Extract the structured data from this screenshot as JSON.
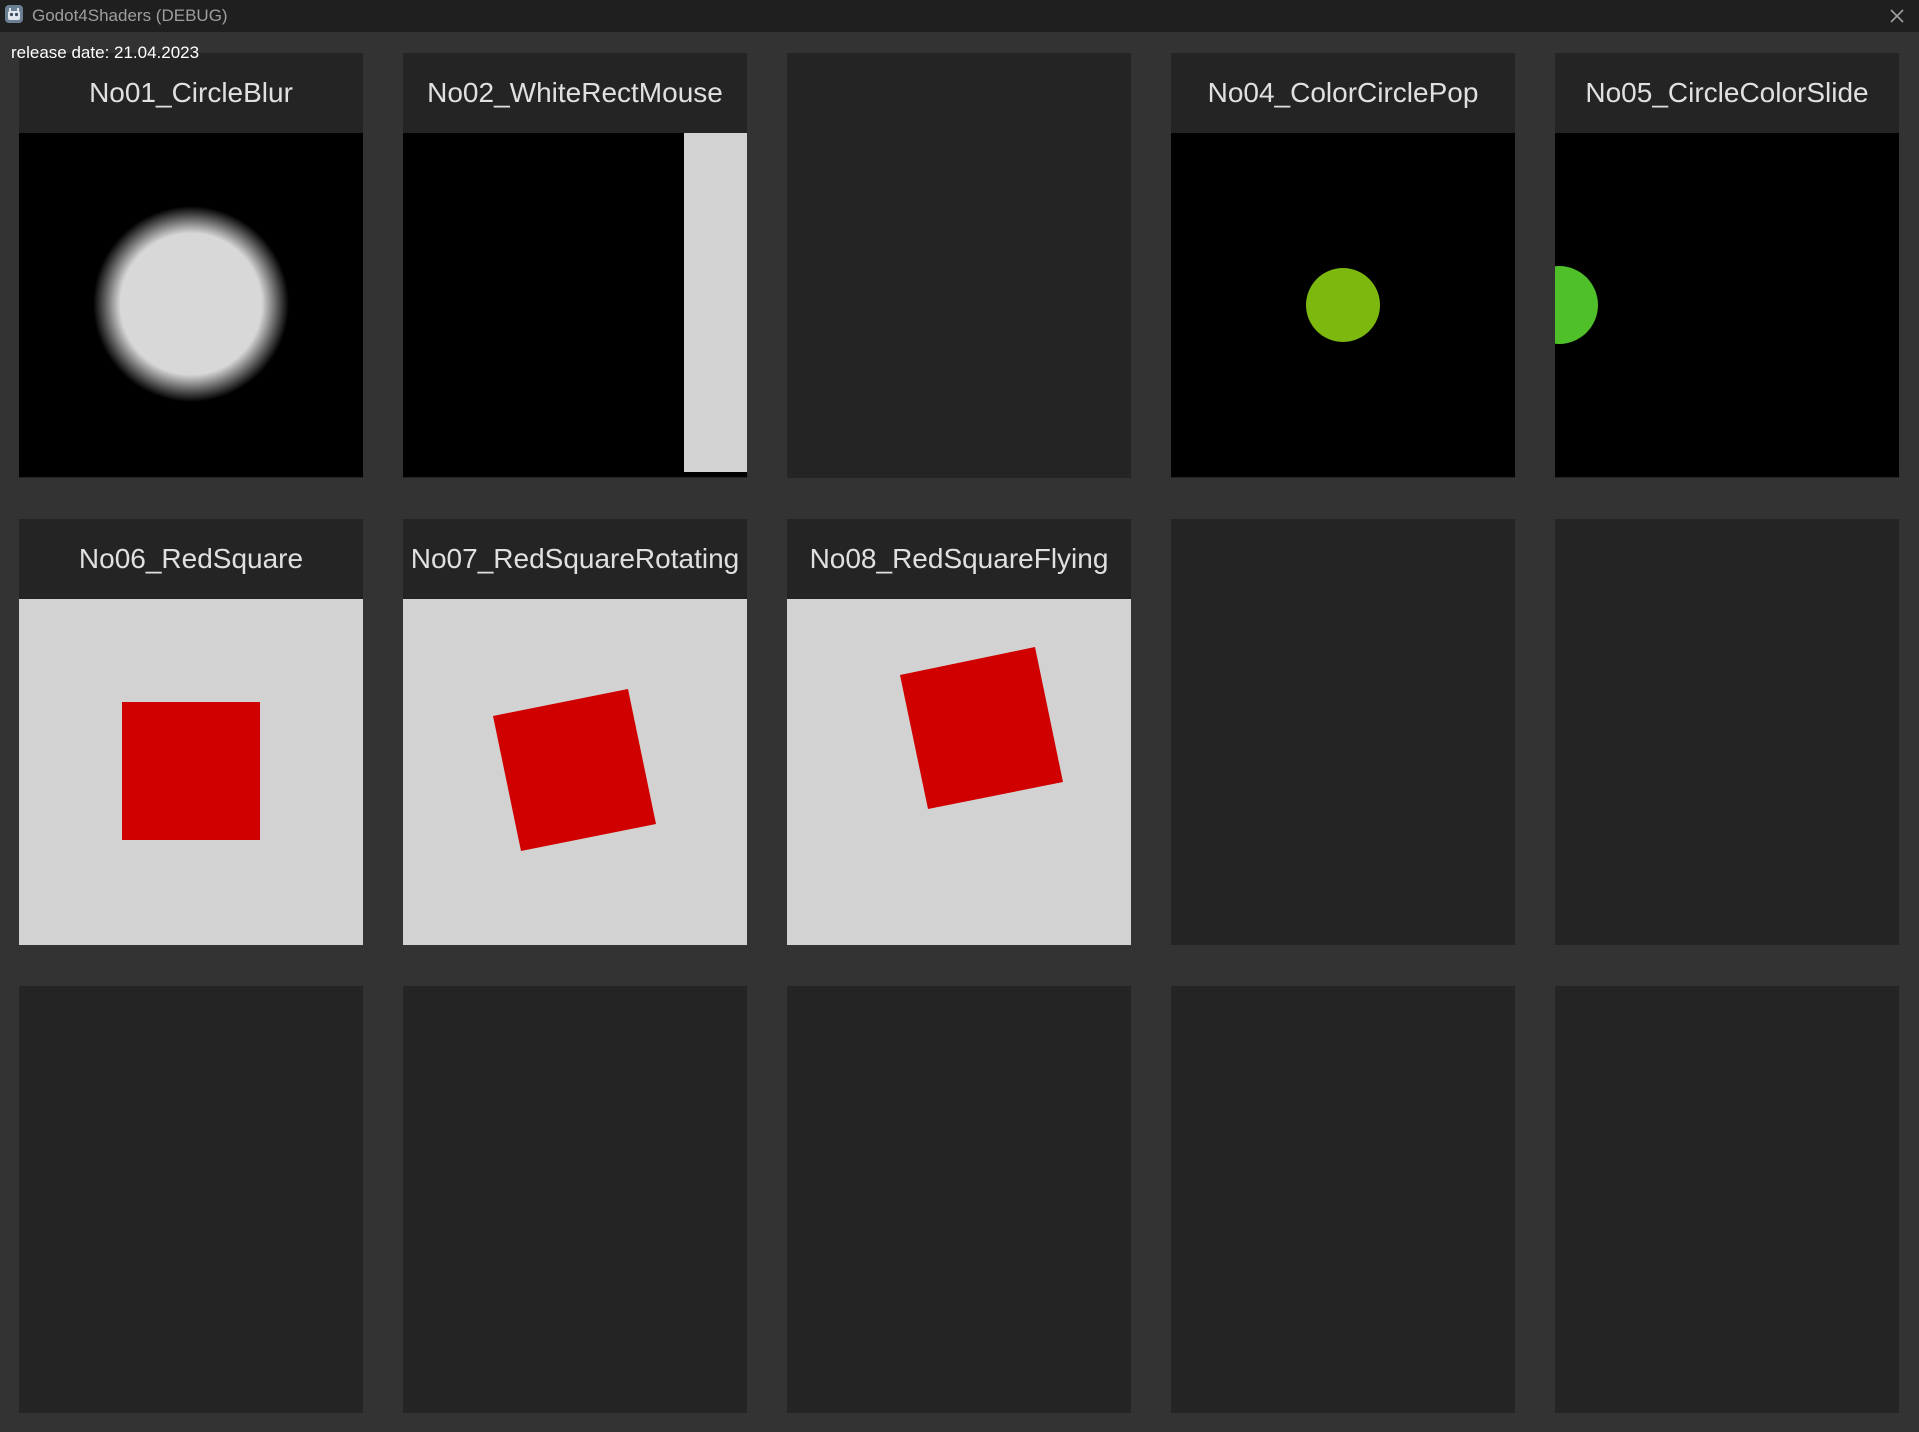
{
  "window": {
    "title": "Godot4Shaders (DEBUG)",
    "app_icon": "godot-icon",
    "close_icon": "close-icon"
  },
  "release_label": "release date: 21.04.2023",
  "panels": [
    {
      "label": "No01_CircleBlur",
      "background": "#000000",
      "shape": "blurred circle",
      "shape_color": "#d8d8d8"
    },
    {
      "label": "No02_WhiteRectMouse",
      "background": "#000000",
      "shape": "rectangle",
      "shape_color": "#d2d2d2"
    },
    {
      "label": "",
      "background": "#242424"
    },
    {
      "label": "No04_ColorCirclePop",
      "background": "#000000",
      "shape": "circle",
      "shape_color": "#7db80e"
    },
    {
      "label": "No05_CircleColorSlide",
      "background": "#000000",
      "shape": "circle",
      "shape_color": "#4fbf2a"
    },
    {
      "label": "No06_RedSquare",
      "background": "#d2d2d2",
      "shape": "square",
      "shape_color": "#d10000"
    },
    {
      "label": "No07_RedSquareRotating",
      "background": "#d2d2d2",
      "shape": "rotated square",
      "shape_color": "#d10000"
    },
    {
      "label": "No08_RedSquareFlying",
      "background": "#d2d2d2",
      "shape": "rotated square",
      "shape_color": "#d10000"
    },
    {
      "label": "",
      "background": "#242424"
    },
    {
      "label": "",
      "background": "#242424"
    },
    {
      "label": "",
      "background": "#242424"
    },
    {
      "label": "",
      "background": "#242424"
    },
    {
      "label": "",
      "background": "#242424"
    },
    {
      "label": "",
      "background": "#242424"
    },
    {
      "label": "",
      "background": "#242424"
    }
  ],
  "colors": {
    "window_background": "#333333",
    "panel_background": "#242424",
    "header_text": "#e0e0e0"
  }
}
